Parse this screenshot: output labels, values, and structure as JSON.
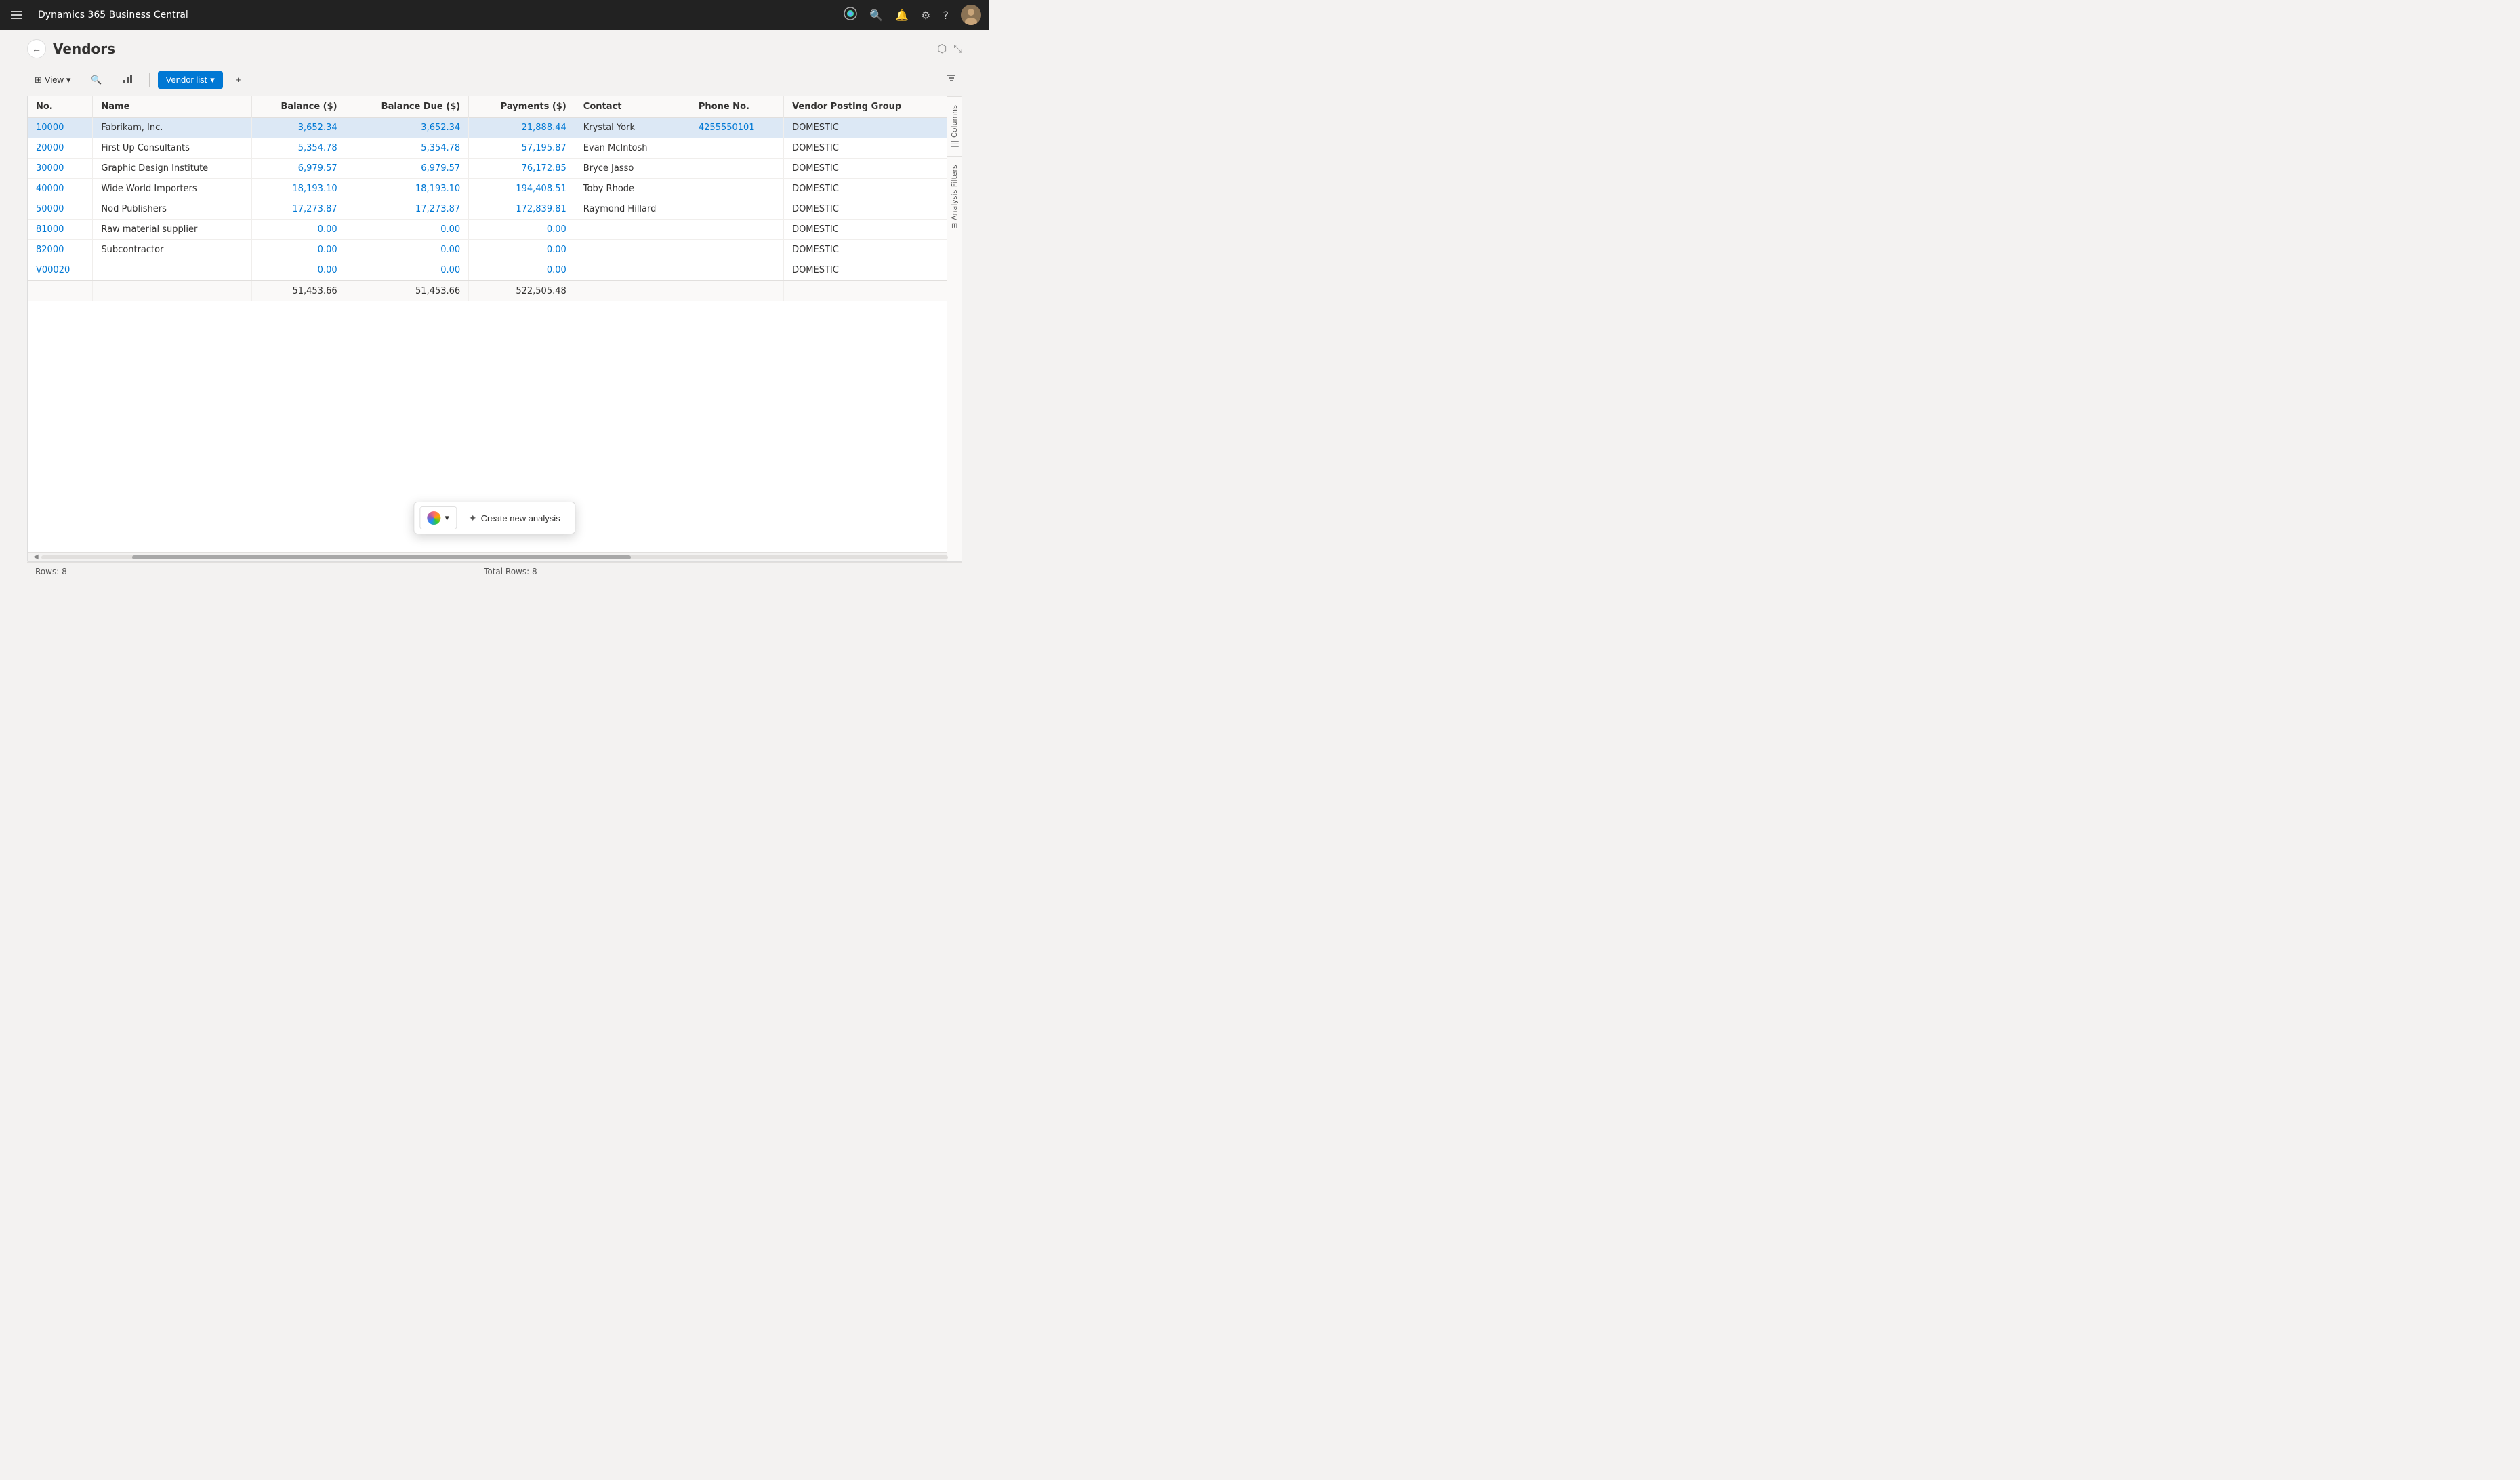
{
  "app": {
    "title": "Dynamics 365 Business Central"
  },
  "header": {
    "back_label": "←",
    "page_title": "Vendors",
    "expand_icon": "⤢",
    "collapse_icon": "⤡"
  },
  "toolbar": {
    "view_label": "View",
    "search_icon": "🔍",
    "analysis_icon": "⊞",
    "tab_label": "Vendor list",
    "tab_dropdown": "▾",
    "add_icon": "+",
    "filter_icon": "⊟"
  },
  "table": {
    "columns": [
      {
        "id": "no",
        "label": "No.",
        "align": "left"
      },
      {
        "id": "name",
        "label": "Name",
        "align": "left"
      },
      {
        "id": "balance",
        "label": "Balance ($)",
        "align": "right"
      },
      {
        "id": "balance_due",
        "label": "Balance Due ($)",
        "align": "right"
      },
      {
        "id": "payments",
        "label": "Payments ($)",
        "align": "right"
      },
      {
        "id": "contact",
        "label": "Contact",
        "align": "left"
      },
      {
        "id": "phone",
        "label": "Phone No.",
        "align": "left"
      },
      {
        "id": "posting_group",
        "label": "Vendor Posting Group",
        "align": "left"
      }
    ],
    "rows": [
      {
        "no": "10000",
        "name": "Fabrikam, Inc.",
        "balance": "3,652.34",
        "balance_due": "3,652.34",
        "payments": "21,888.44",
        "contact": "Krystal York",
        "phone": "4255550101",
        "posting_group": "DOMESTIC",
        "selected": true
      },
      {
        "no": "20000",
        "name": "First Up Consultants",
        "balance": "5,354.78",
        "balance_due": "5,354.78",
        "payments": "57,195.87",
        "contact": "Evan McIntosh",
        "phone": "",
        "posting_group": "DOMESTIC",
        "selected": false
      },
      {
        "no": "30000",
        "name": "Graphic Design Institute",
        "balance": "6,979.57",
        "balance_due": "6,979.57",
        "payments": "76,172.85",
        "contact": "Bryce Jasso",
        "phone": "",
        "posting_group": "DOMESTIC",
        "selected": false
      },
      {
        "no": "40000",
        "name": "Wide World Importers",
        "balance": "18,193.10",
        "balance_due": "18,193.10",
        "payments": "194,408.51",
        "contact": "Toby Rhode",
        "phone": "",
        "posting_group": "DOMESTIC",
        "selected": false
      },
      {
        "no": "50000",
        "name": "Nod Publishers",
        "balance": "17,273.87",
        "balance_due": "17,273.87",
        "payments": "172,839.81",
        "contact": "Raymond Hillard",
        "phone": "",
        "posting_group": "DOMESTIC",
        "selected": false
      },
      {
        "no": "81000",
        "name": "Raw material supplier",
        "balance": "0.00",
        "balance_due": "0.00",
        "payments": "0.00",
        "contact": "",
        "phone": "",
        "posting_group": "DOMESTIC",
        "selected": false
      },
      {
        "no": "82000",
        "name": "Subcontractor",
        "balance": "0.00",
        "balance_due": "0.00",
        "payments": "0.00",
        "contact": "",
        "phone": "",
        "posting_group": "DOMESTIC",
        "selected": false
      },
      {
        "no": "V00020",
        "name": "",
        "balance": "0.00",
        "balance_due": "0.00",
        "payments": "0.00",
        "contact": "",
        "phone": "",
        "posting_group": "DOMESTIC",
        "selected": false
      }
    ],
    "totals": {
      "balance": "51,453.66",
      "balance_due": "51,453.66",
      "payments": "522,505.48"
    }
  },
  "side_tabs": [
    {
      "id": "columns",
      "label": "Columns",
      "icon": "|||"
    },
    {
      "id": "analysis_filters",
      "label": "Analysis Filters",
      "icon": "⊟"
    }
  ],
  "status_bar": {
    "rows_label": "Rows: 8",
    "total_rows_label": "Total Rows: 8"
  },
  "floating_bar": {
    "copilot_label": "▾",
    "create_analysis_label": "Create new analysis",
    "sparkle_label": "✦"
  },
  "colors": {
    "link": "#0078d4",
    "selected_row": "#dce8f5",
    "topbar": "#1f1f1f",
    "accent": "#0078d4"
  }
}
